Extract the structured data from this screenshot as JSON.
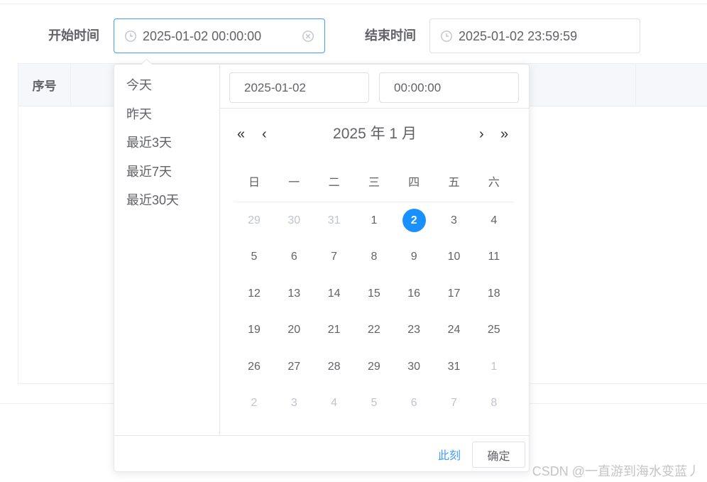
{
  "form": {
    "start_label": "开始时间",
    "start_value": "2025-01-02 00:00:00",
    "end_label": "结束时间",
    "end_value": "2025-01-02 23:59:59"
  },
  "table": {
    "header_seq": "序号"
  },
  "picker": {
    "shortcuts": [
      "今天",
      "昨天",
      "最近3天",
      "最近7天",
      "最近30天"
    ],
    "date_input": "2025-01-02",
    "time_input": "00:00:00",
    "title": "2025 年  1 月",
    "nav": {
      "prev_year": "«",
      "prev_month": "‹",
      "next_month": "›",
      "next_year": "»"
    },
    "weekdays": [
      "日",
      "一",
      "二",
      "三",
      "四",
      "五",
      "六"
    ],
    "weeks": [
      [
        {
          "d": "29",
          "m": true
        },
        {
          "d": "30",
          "m": true
        },
        {
          "d": "31",
          "m": true
        },
        {
          "d": "1"
        },
        {
          "d": "2",
          "s": true
        },
        {
          "d": "3"
        },
        {
          "d": "4"
        }
      ],
      [
        {
          "d": "5"
        },
        {
          "d": "6"
        },
        {
          "d": "7"
        },
        {
          "d": "8"
        },
        {
          "d": "9"
        },
        {
          "d": "10"
        },
        {
          "d": "11"
        }
      ],
      [
        {
          "d": "12"
        },
        {
          "d": "13"
        },
        {
          "d": "14"
        },
        {
          "d": "15"
        },
        {
          "d": "16"
        },
        {
          "d": "17"
        },
        {
          "d": "18"
        }
      ],
      [
        {
          "d": "19"
        },
        {
          "d": "20"
        },
        {
          "d": "21"
        },
        {
          "d": "22"
        },
        {
          "d": "23"
        },
        {
          "d": "24"
        },
        {
          "d": "25"
        }
      ],
      [
        {
          "d": "26"
        },
        {
          "d": "27"
        },
        {
          "d": "28"
        },
        {
          "d": "29"
        },
        {
          "d": "30"
        },
        {
          "d": "31"
        },
        {
          "d": "1",
          "m": true
        }
      ],
      [
        {
          "d": "2",
          "m": true
        },
        {
          "d": "3",
          "m": true
        },
        {
          "d": "4",
          "m": true
        },
        {
          "d": "5",
          "m": true
        },
        {
          "d": "6",
          "m": true
        },
        {
          "d": "7",
          "m": true
        },
        {
          "d": "8",
          "m": true
        }
      ]
    ],
    "now_label": "此刻",
    "confirm_label": "确定"
  },
  "watermark": "CSDN @一直游到海水变蓝丿",
  "colors": {
    "accent": "#409eff",
    "selected_day": "#1890ff",
    "muted": "#c0c4cc"
  },
  "icons": {
    "input_prefix": "clock-icon",
    "clear": "circle-close-icon"
  }
}
